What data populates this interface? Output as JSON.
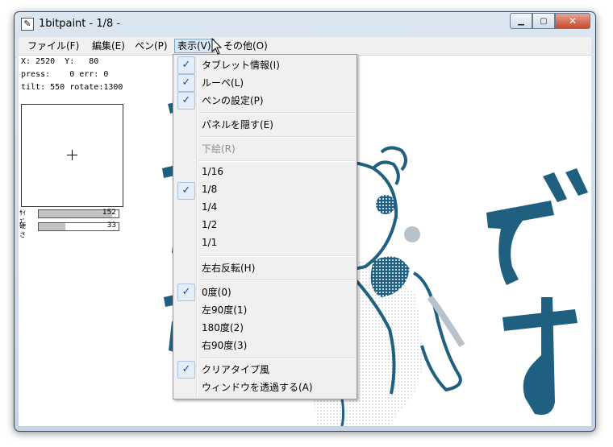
{
  "window": {
    "title": "1bitpaint - 1/8 -",
    "title_icon": "pen-icon",
    "controls": {
      "minimize": "minimize-icon",
      "maximize": "maximize-icon",
      "close": "close-icon"
    }
  },
  "menubar": {
    "items": [
      {
        "label": "ファイル(F)"
      },
      {
        "label": "編集(E)"
      },
      {
        "label": "ペン(P)"
      },
      {
        "label": "表示(V)"
      },
      {
        "label": "その他(O)"
      }
    ],
    "active": "表示(V)"
  },
  "status": {
    "line1": "X: 2520  Y:   80",
    "line2": "press:    0 err: 0",
    "line3": "tilt: 550 rotate:1300"
  },
  "sliders": [
    {
      "label": "ｻｲｽﾞ",
      "value": "152",
      "fraction": 0.92
    },
    {
      "label": "硬さ",
      "value": "33",
      "fraction": 0.33
    }
  ],
  "view_menu": {
    "items": [
      {
        "label": "タブレット情報(I)",
        "checked": true,
        "enabled": true
      },
      {
        "label": "ルーペ(L)",
        "checked": true,
        "enabled": true
      },
      {
        "label": "ペンの設定(P)",
        "checked": true,
        "enabled": true
      },
      {
        "label": "パネルを隠す(E)",
        "checked": false,
        "enabled": true
      },
      {
        "label": "下絵(R)",
        "checked": false,
        "enabled": false
      },
      {
        "label": "1/16",
        "checked": false,
        "enabled": true
      },
      {
        "label": "1/8",
        "checked": true,
        "enabled": true
      },
      {
        "label": "1/4",
        "checked": false,
        "enabled": true
      },
      {
        "label": "1/2",
        "checked": false,
        "enabled": true
      },
      {
        "label": "1/1",
        "checked": false,
        "enabled": true
      },
      {
        "label": "左右反転(H)",
        "checked": false,
        "enabled": true
      },
      {
        "label": "0度(0)",
        "checked": true,
        "enabled": true
      },
      {
        "label": "左90度(1)",
        "checked": false,
        "enabled": true
      },
      {
        "label": "180度(2)",
        "checked": false,
        "enabled": true
      },
      {
        "label": "右90度(3)",
        "checked": false,
        "enabled": true
      },
      {
        "label": "クリアタイプ風",
        "checked": true,
        "enabled": true
      },
      {
        "label": "ウィンドウを透過する(A)",
        "checked": false,
        "enabled": true
      }
    ]
  },
  "canvas": {
    "ink_color": "#1f5f7f",
    "text": "です"
  },
  "colors": {
    "menu_highlight": "#dbe8f5",
    "check_mark": "#1b4d8c",
    "disabled_text": "#8d8d8d"
  }
}
